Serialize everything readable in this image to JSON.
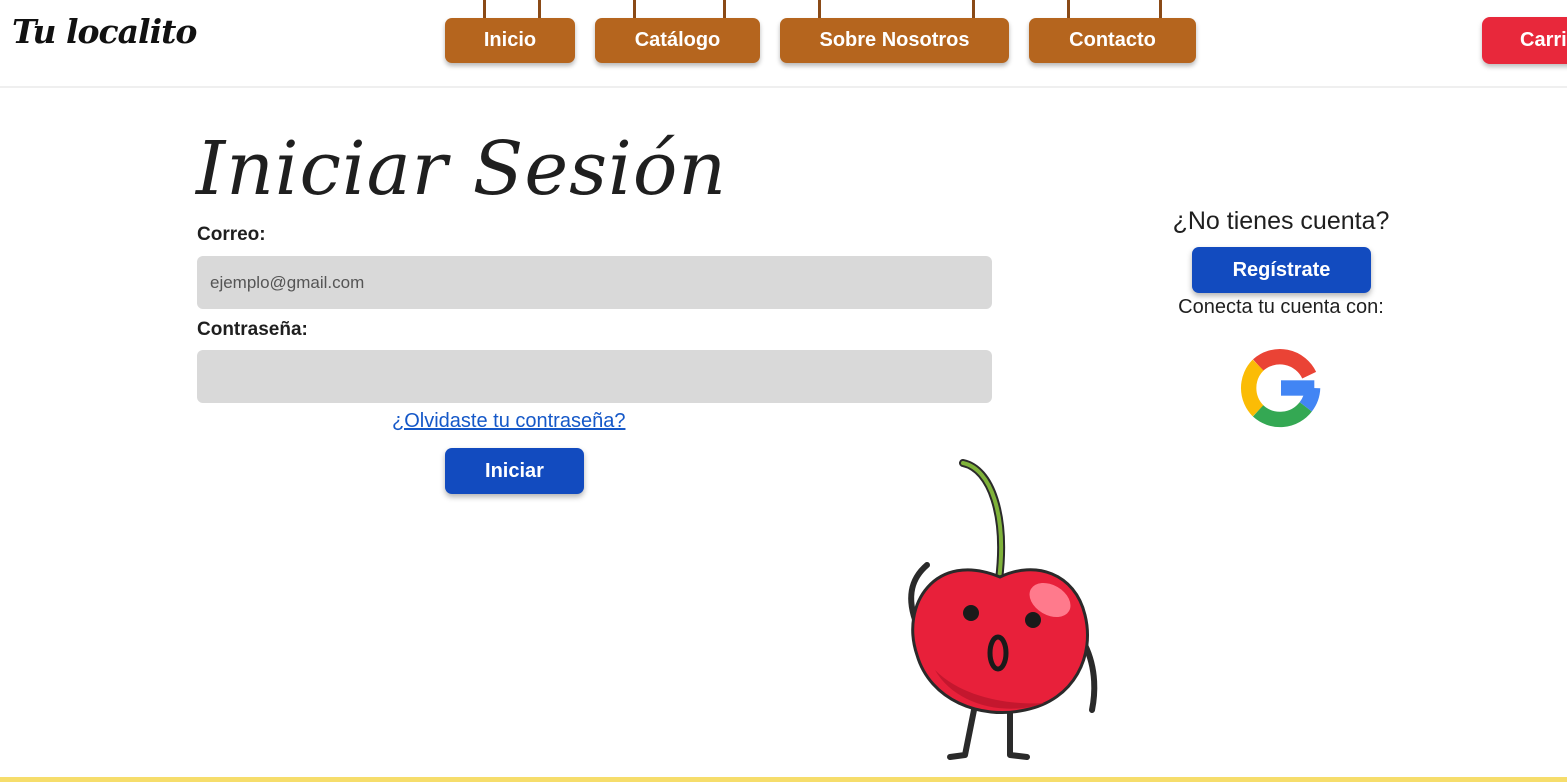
{
  "header": {
    "logo": "Tu localito",
    "nav": [
      {
        "label": "Inicio"
      },
      {
        "label": "Catálogo"
      },
      {
        "label": "Sobre Nosotros"
      },
      {
        "label": "Contacto"
      }
    ],
    "cart_label": "Carri"
  },
  "login": {
    "title": "Iniciar Sesión",
    "email_label": "Correo:",
    "email_placeholder": "ejemplo@gmail.com",
    "email_value": "",
    "password_label": "Contraseña:",
    "password_value": "",
    "forgot_link": "¿Olvidaste tu contraseña?",
    "submit_label": "Iniciar"
  },
  "signup": {
    "question": "¿No tienes cuenta?",
    "register_label": "Regístrate",
    "connect_text": "Conecta tu cuenta con:",
    "provider_icon": "google-icon"
  },
  "colors": {
    "nav_brown": "#b5651e",
    "primary_blue": "#124bbf",
    "cart_red": "#e8283b",
    "input_gray": "#d9d9d9",
    "link_blue": "#1558c8",
    "footer_yellow": "#f6dd6b"
  }
}
